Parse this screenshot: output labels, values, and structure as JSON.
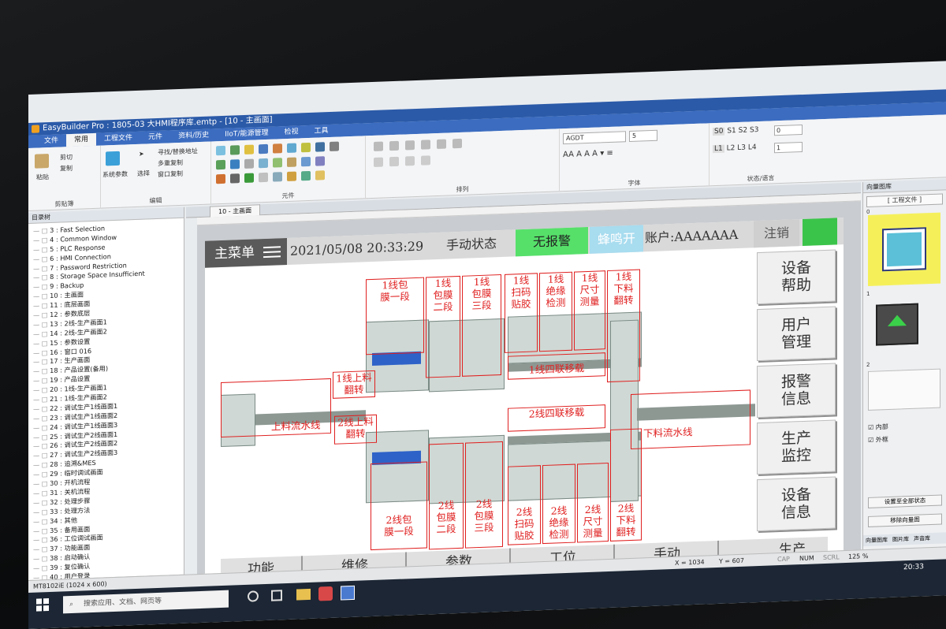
{
  "window": {
    "title": "EasyBuilder Pro : 1805-03 大HMI程序库.emtp - [10 - 主画面]"
  },
  "menubar": [
    "文件",
    "常用",
    "工程文件",
    "元件",
    "资料/历史",
    "IIoT/能源管理",
    "检视",
    "工具"
  ],
  "ribbon": {
    "clipboard": {
      "paste": "粘贴",
      "cut": "剪切",
      "copy": "复制",
      "group": "剪贴簿"
    },
    "system_params": "系统参数",
    "select": "选择",
    "addr_find": "寻找/替换地址",
    "multi_copy": "多重复制",
    "window_copy": "窗口复制",
    "edit_group": "编辑",
    "elements_group": "元件",
    "arrange_group": "排列",
    "font_name": "AGDT",
    "font_size": "5",
    "font_group": "字体",
    "states": [
      "S0",
      "S1",
      "S2",
      "S3"
    ],
    "state_value": "0",
    "langs": [
      "L1",
      "L2",
      "L3",
      "L4"
    ],
    "lang_value": "1",
    "state_group": "状态/语言"
  },
  "tree": {
    "header": "目录树",
    "items": [
      "3 : Fast Selection",
      "4 : Common Window",
      "5 : PLC Response",
      "6 : HMI Connection",
      "7 : Password Restriction",
      "8 : Storage Space Insufficient",
      "9 : Backup",
      "10 : 主画面",
      "11 : 底层画面",
      "12 : 参数底层",
      "13 : 2线-生产画面1",
      "14 : 2线-生产画面2",
      "15 : 参数设置",
      "16 : 窗口 016",
      "17 : 生产画面",
      "18 : 产品设置(备用)",
      "19 : 产品设置",
      "20 : 1线-生产画面1",
      "21 : 1线-生产画面2",
      "22 : 调试生产1线画面1",
      "23 : 调试生产1线画面2",
      "24 : 调试生产1线画面3",
      "25 : 调试生产2线画面1",
      "26 : 调试生产2线画面2",
      "27 : 调试生产2线画面3",
      "28 : 追溯&MES",
      "29 : 临时调试画面",
      "30 : 开机流程",
      "31 : 关机流程",
      "32 : 处理步骤",
      "33 : 处理方法",
      "34 : 其他",
      "35 : 备用画面",
      "36 : 工位调试画面",
      "37 : 功能画面",
      "38 : 启动确认",
      "39 : 复位确认",
      "40 : 用户登录"
    ],
    "footer": "地址    自建库    窗口预览    资料"
  },
  "tab": {
    "label": "10 - 主画面"
  },
  "hmi": {
    "main_menu": "主菜单",
    "datetime": "2021/05/08 20:33:29",
    "mode": "手动状态",
    "alarm": "无报警",
    "buzzer": "蜂鸣开",
    "account": "账户:AAAAAAA",
    "logout": "注销",
    "side_buttons": [
      [
        "设备",
        "帮助"
      ],
      [
        "用户",
        "管理"
      ],
      [
        "报警",
        "信息"
      ],
      [
        "生产",
        "监控"
      ],
      [
        "设备",
        "信息"
      ],
      [
        "生产",
        ""
      ]
    ],
    "bottom_buttons": [
      "功能",
      "维修",
      "参数",
      "工位",
      "手动"
    ],
    "stations_top": [
      [
        "1线包",
        "膜一段"
      ],
      [
        "1线",
        "包膜",
        "二段"
      ],
      [
        "1线",
        "包膜",
        "三段"
      ],
      [
        "1线",
        "扫码",
        "贴胶"
      ],
      [
        "1线",
        "绝缘",
        "检测"
      ],
      [
        "1线",
        "尺寸",
        "测量"
      ],
      [
        "1线",
        "下料",
        "翻转"
      ]
    ],
    "stations_bottom": [
      [
        "2线包",
        "膜一段"
      ],
      [
        "2线",
        "包膜",
        "二段"
      ],
      [
        "2线",
        "包膜",
        "三段"
      ],
      [
        "2线",
        "扫码",
        "贴胶"
      ],
      [
        "2线",
        "绝缘",
        "检测"
      ],
      [
        "2线",
        "尺寸",
        "测量"
      ],
      [
        "2线",
        "下料",
        "翻转"
      ]
    ],
    "line1_flip": [
      "1线上料",
      "翻转"
    ],
    "line2_flip": [
      "2线上料",
      "翻转"
    ],
    "line1_transfer": "1线四联移载",
    "line2_transfer": "2线四联移载",
    "infeed": "上料流水线",
    "outfeed": "下料流水线"
  },
  "rightpanel": {
    "header": "向量图库",
    "project_files": "[ 工程文件 ]",
    "indices": [
      "0",
      "1",
      "2"
    ],
    "inner": "内部",
    "outer": "外框",
    "set_state": "设置至全部状态",
    "move_vector": "移除向量图",
    "tabs": [
      "向量图库",
      "图片库",
      "声音库"
    ]
  },
  "statusbar": {
    "model": "MT8102iE (1024 x 600)",
    "x": "X = 1034",
    "y": "Y = 607",
    "cap": "CAP",
    "num": "NUM",
    "scrl": "SCRL",
    "zoom": "125 %"
  },
  "taskbar": {
    "search_placeholder": "搜索应用、文档、网页等",
    "time": "20:33"
  },
  "colors": {
    "alarm_green": "#56e06a",
    "buzzer_blue": "#a8dcef",
    "label_red": "#e02020",
    "menu_dark": "#5a5a5a"
  }
}
